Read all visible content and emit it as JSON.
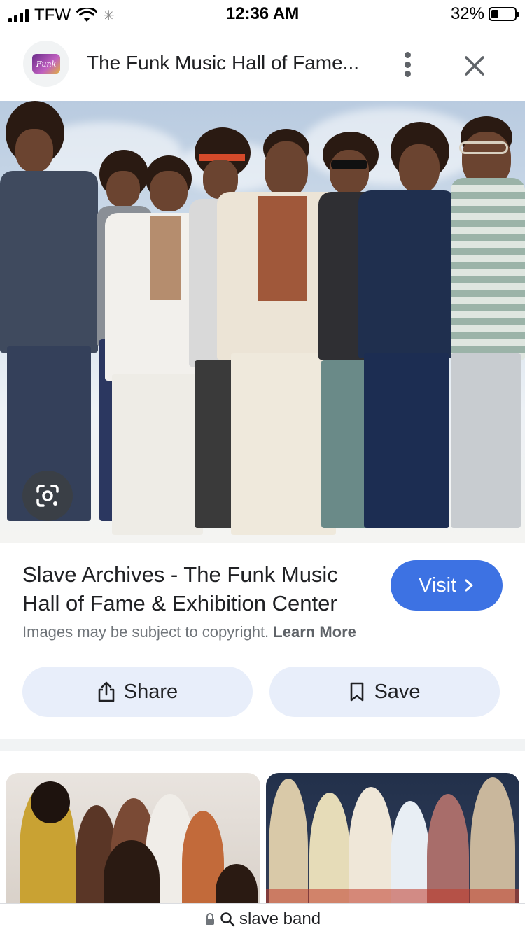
{
  "status_bar": {
    "carrier": "TFW",
    "time": "12:36 AM",
    "battery_percent": "32%",
    "battery_level": 0.32,
    "icons": [
      "signal-icon",
      "wifi-icon",
      "activity-spinner-icon",
      "battery-icon"
    ]
  },
  "header": {
    "favicon_text": "Funk",
    "title": "The Funk Music Hall of Fame...",
    "more_icon": "more-vert-icon",
    "close_icon": "close-icon"
  },
  "hero": {
    "lens_icon": "google-lens-icon"
  },
  "result": {
    "title": "Slave Archives - The Funk Music Hall of Fame & Exhibition Center",
    "visit_label": "Visit",
    "visit_icon": "chevron-right-icon",
    "copyright_text": "Images may be subject to copyright.",
    "learn_more": "Learn More"
  },
  "actions": {
    "share_label": "Share",
    "share_icon": "share-icon",
    "save_label": "Save",
    "save_icon": "bookmark-icon"
  },
  "url_bar": {
    "lock_icon": "lock-icon",
    "search_icon": "search-icon",
    "query": "slave band"
  },
  "colors": {
    "accent": "#3d72e3",
    "action_bg": "#e8eefa",
    "secondary_text": "#70757a"
  }
}
